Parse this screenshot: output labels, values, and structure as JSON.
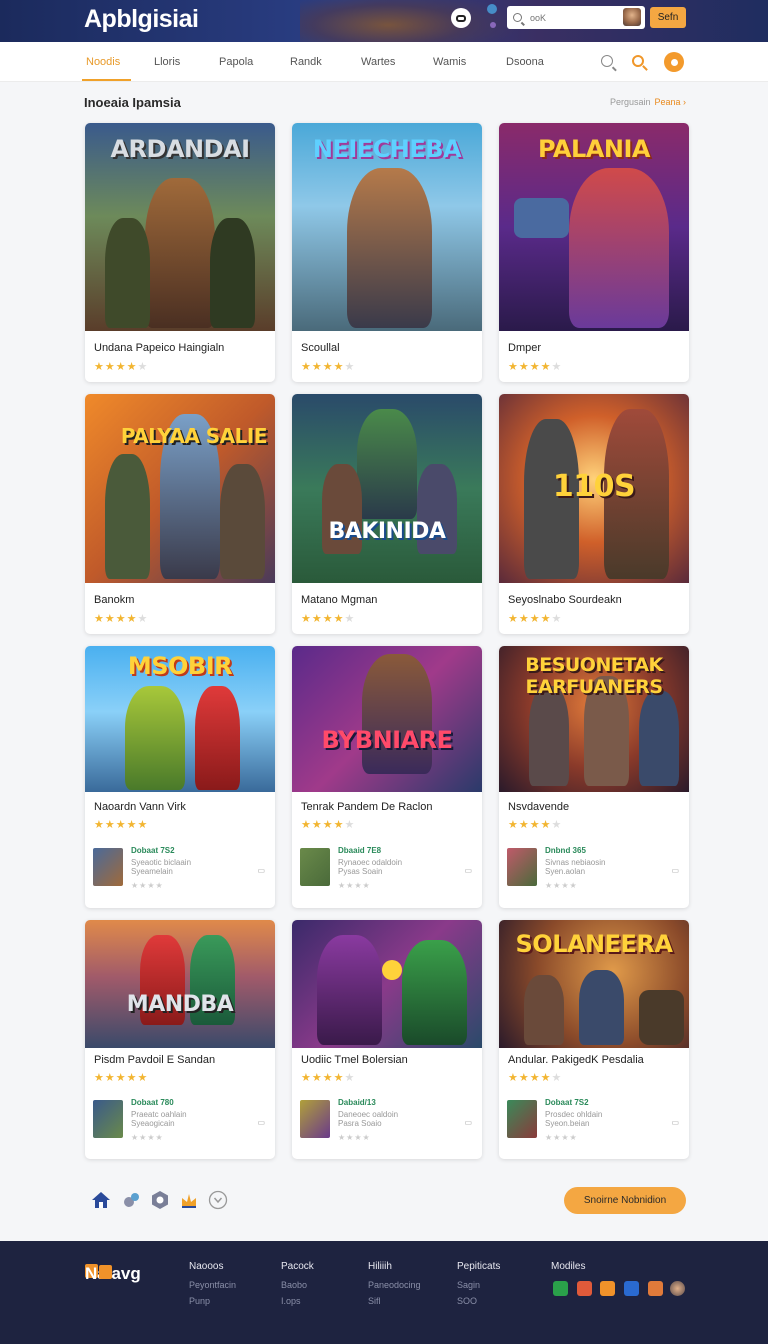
{
  "header": {
    "brand": "Apblgisiai",
    "search_placeholder": "ooK",
    "signin_label": "Sefn"
  },
  "nav": {
    "tabs": [
      "Noodis",
      "Lloris",
      "Papola",
      "Randk",
      "Wartes",
      "Wamis",
      "Dsoona"
    ],
    "active_tab": "Noodis"
  },
  "section": {
    "title": "Inoeaia Ipamsia",
    "link_prefix": "Pergusain",
    "link_label": "Peana ›"
  },
  "games": [
    {
      "title": "ARDANDAI",
      "name": "Undana Papeico Haingialn",
      "rating": 4
    },
    {
      "title": "NEIECHEBA",
      "name": "Scoullal",
      "rating": 4
    },
    {
      "title": "PALANIA",
      "name": "Dmper",
      "rating": 4
    },
    {
      "title": "PALYAA SALIE",
      "name": "Banokm",
      "rating": 4
    },
    {
      "title": "BAKINIDA",
      "name": "Matano Mgman",
      "rating": 4
    },
    {
      "title": "110S",
      "name": "Seyoslnabo Sourdeakn",
      "rating": 4
    },
    {
      "title": "MSOBIR",
      "name": "Naoardn Vann Virk",
      "rating": 5,
      "sub": {
        "line1": "Dobaat 7S2",
        "line2": "Syeaotic biclaain",
        "line3": "Syeamelain"
      }
    },
    {
      "title": "BYBNIARE",
      "name": "Tenrak Pandem De Raclon",
      "rating": 4,
      "sub": {
        "line1": "Dbaaid 7E8",
        "line2": "Rynaoec odaldoin",
        "line3": "Pysas Soain"
      }
    },
    {
      "title": "BESUONETAK EARFUANERS",
      "name": "Nsvdavende",
      "rating": 4,
      "sub": {
        "line1": "Dnbnd 365",
        "line2": "Sivnas nebiaosin",
        "line3": "Syen.aolan"
      }
    },
    {
      "title": "MANDBA",
      "name": "Pisdm Pavdoil E Sandan",
      "rating": 5,
      "sub": {
        "line1": "Dobaat 780",
        "line2": "Praeatc oahlain",
        "line3": "Syeaogicain"
      }
    },
    {
      "title": "",
      "name": "Uodiic Tmel Bolersian",
      "rating": 4,
      "sub": {
        "line1": "Dabaid/13",
        "line2": "Daneoec oaldoin",
        "line3": "Pasra Soaio"
      }
    },
    {
      "title": "SOLANEERA",
      "name": "Andular. PakigedK Pesdalia",
      "rating": 4,
      "sub": {
        "line1": "Dobaat 7S2",
        "line2": "Prosdec ohldain",
        "line3": "Syeon.beian"
      }
    }
  ],
  "bottom": {
    "more_label": "Snoirne Nobnidion",
    "icons": [
      "home-icon",
      "puzzle-icon",
      "gear-icon",
      "trophy-icon",
      "chevron-down-icon"
    ]
  },
  "footer": {
    "logo": "Nalavg",
    "columns": [
      {
        "heading": "Naooos",
        "items": [
          "Peyontfacin",
          "Punp"
        ]
      },
      {
        "heading": "Pacock",
        "items": [
          "Baobo",
          "I.ops"
        ]
      },
      {
        "heading": "Hiliiih",
        "items": [
          "Paneodocing",
          "Sifl"
        ]
      },
      {
        "heading": "Pepiticats",
        "items": [
          "Sagin",
          "SOO"
        ]
      },
      {
        "heading": "Modiles",
        "items": []
      }
    ]
  }
}
